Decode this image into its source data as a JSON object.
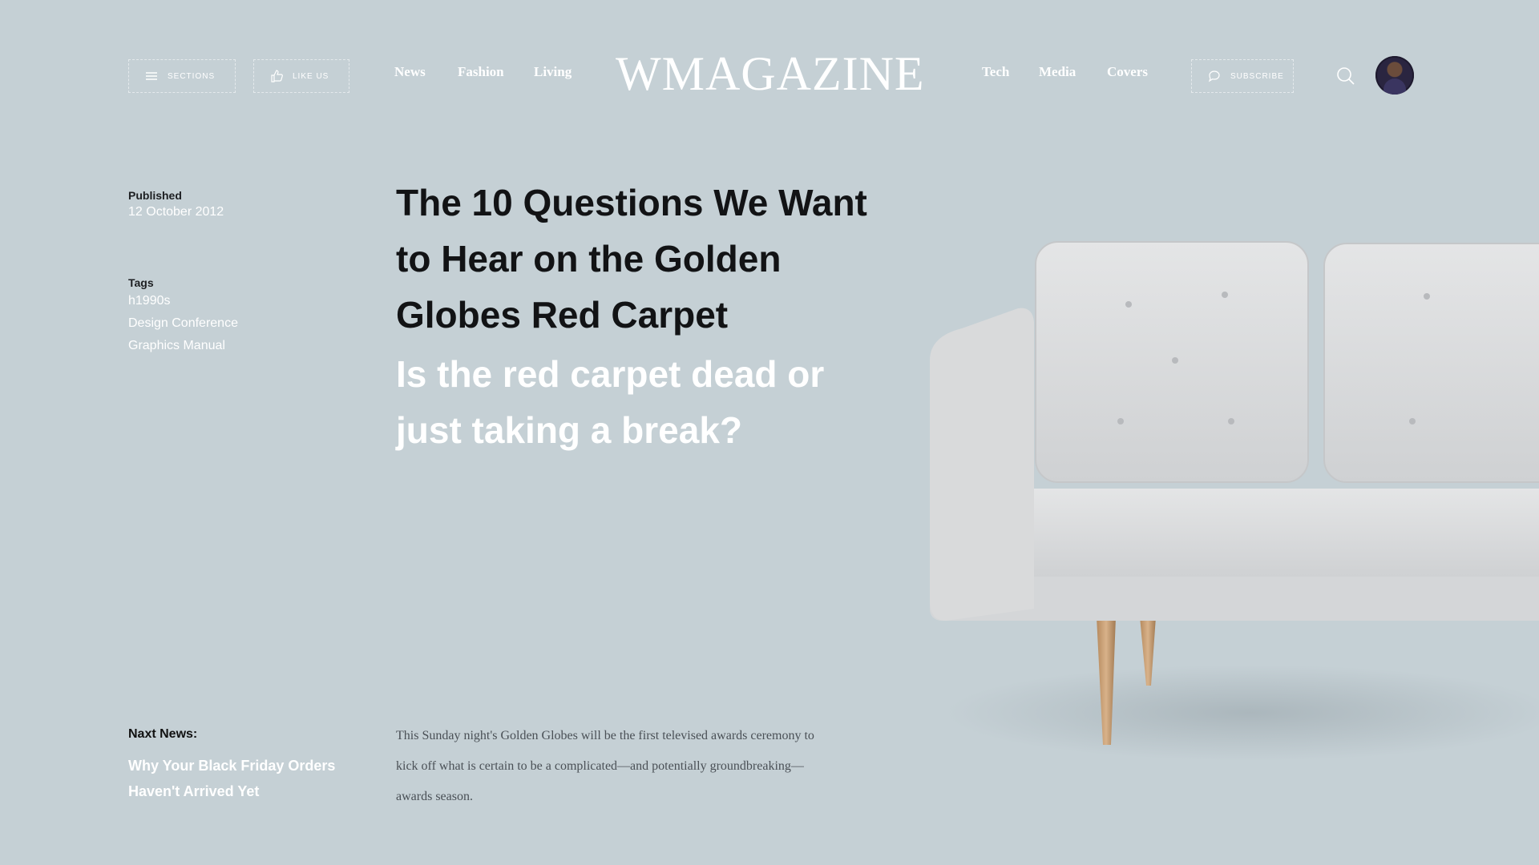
{
  "header": {
    "sections_label": "Sections",
    "like_label": "Like us",
    "nav_left": [
      "News",
      "Fashion",
      "Living"
    ],
    "logo": "WMAGAZINE",
    "nav_right": [
      "Tech",
      "Media",
      "Covers"
    ],
    "subscribe_label": "Subscribe"
  },
  "meta": {
    "published_label": "Published",
    "published_date": "12 October 2012",
    "tags_label": "Tags",
    "tags": [
      "h1990s",
      "Design Conference",
      "Graphics Manual"
    ]
  },
  "article": {
    "headline": "The 10 Questions We Want to Hear on the Golden Globes Red Carpet",
    "subheadline": "Is the red carpet dead or just taking a break?",
    "body": "This Sunday night's Golden Globes will be the first televised awards ceremony to kick off what is certain to be a complicated—and potentially groundbreaking—awards season."
  },
  "next_news": {
    "label": "Naxt News:",
    "title": "Why Your Black Friday Orders Haven't Arrived Yet"
  },
  "colors": {
    "background": "#c5d0d5",
    "headline": "#121315",
    "accent_text": "#ffffff"
  },
  "icons": [
    "menu-icon",
    "thumbs-up-icon",
    "chat-icon",
    "search-icon",
    "avatar"
  ]
}
